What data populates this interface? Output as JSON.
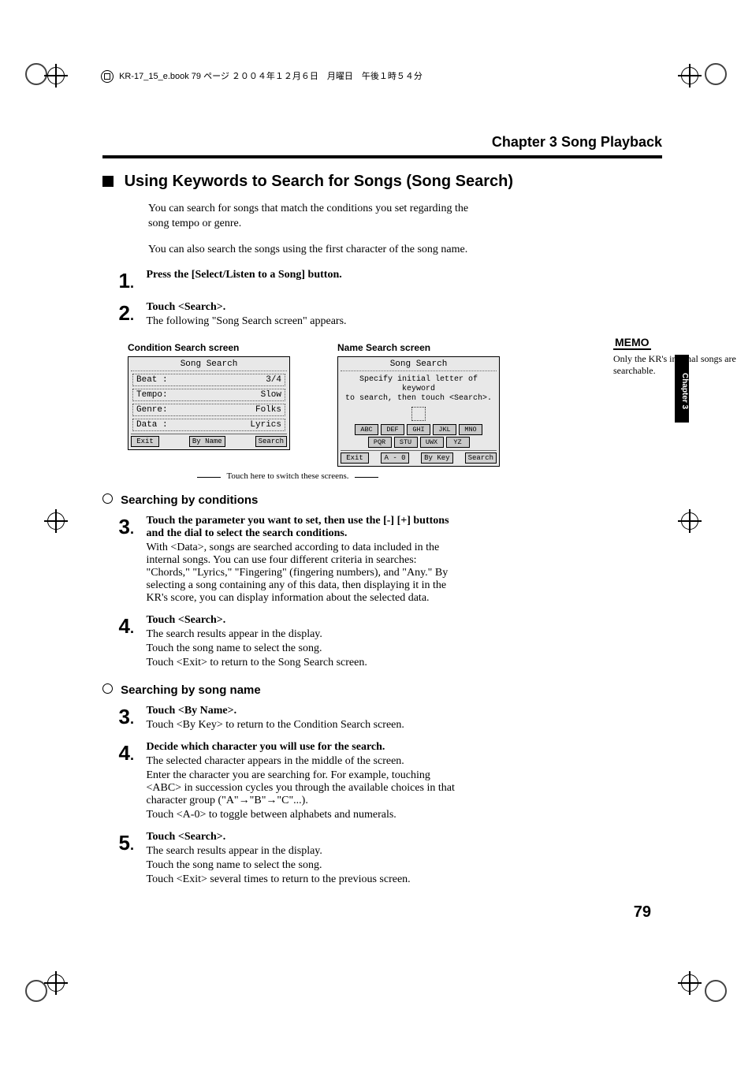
{
  "meta": {
    "header_line": "KR-17_15_e.book 79 ページ ２００４年１２月６日　月曜日　午後１時５４分"
  },
  "chapter_header": "Chapter 3 Song Playback",
  "section_title": "Using Keywords to Search for Songs (Song Search)",
  "intro": {
    "p1": "You can search for songs that match the conditions you set regarding the song tempo or genre.",
    "p2": "You can also search the songs using the first character of the song name."
  },
  "steps_top": {
    "s1": {
      "num": "1",
      "text": "Press the [Select/Listen to a Song] button."
    },
    "s2": {
      "num": "2",
      "text": "Touch <Search>.",
      "after": "The following \"Song Search screen\" appears."
    }
  },
  "screens": {
    "left_label": "Condition Search screen",
    "right_label": "Name Search screen",
    "lcd_title": "Song Search",
    "cond": {
      "row1_l": "Beat :",
      "row1_r": "3/4",
      "row2_l": "Tempo:",
      "row2_r": "Slow",
      "row3_l": "Genre:",
      "row3_r": "Folks",
      "row4_l": "Data :",
      "row4_r": "Lyrics",
      "btn_exit": "Exit",
      "btn_byname": "By Name",
      "btn_search": "Search"
    },
    "name": {
      "hint1": "Specify initial letter of keyword",
      "hint2": "to search, then touch <Search>.",
      "keys1": [
        "ABC",
        "DEF",
        "GHI",
        "JKL",
        "MNO"
      ],
      "keys2": [
        "PQR",
        "STU",
        "UWX",
        "YZ"
      ],
      "btn_exit": "Exit",
      "btn_a0": "A - 0",
      "btn_bykey": "By Key",
      "btn_search": "Search"
    },
    "switch_caption": "Touch here to switch these screens."
  },
  "sub1_title": "Searching by conditions",
  "sub1": {
    "s3": {
      "num": "3",
      "text": "Touch the parameter you want to set, then use the [-] [+] buttons and the dial to select the search conditions.",
      "p1": "With <Data>, songs are searched according to data included in the internal songs. You can use four different criteria in searches: \"Chords,\" \"Lyrics,\" \"Fingering\" (fingering numbers), and \"Any.\" By selecting a song containing any of this data, then displaying it in the KR's score, you can display information about the selected data."
    },
    "s4": {
      "num": "4",
      "text": "Touch <Search>.",
      "p1": "The search results appear in the display.",
      "p2": "Touch the song name to select the song.",
      "p3": "Touch <Exit> to return to the Song Search screen."
    }
  },
  "sub2_title": "Searching by song name",
  "sub2": {
    "s3": {
      "num": "3",
      "text": "Touch <By Name>.",
      "p1": "Touch <By Key> to return to the Condition Search screen."
    },
    "s4": {
      "num": "4",
      "text": "Decide which character you will use for the search.",
      "p1": "The selected character appears in the middle of the screen.",
      "p2": "Enter the character you are searching for. For example, touching <ABC> in succession cycles you through the available choices in that character group (\"A\"→\"B\"→\"C\"...).",
      "p3": "Touch <A-0> to toggle between alphabets and numerals."
    },
    "s5": {
      "num": "5",
      "text": "Touch <Search>.",
      "p1": "The search results appear in the display.",
      "p2": "Touch the song name to select the song.",
      "p3": "Touch <Exit> several times to return to the previous screen."
    }
  },
  "memo": {
    "label": "MEMO",
    "text": "Only the KR's internal songs are searchable."
  },
  "side_tab": "Chapter 3",
  "page_number": "79"
}
